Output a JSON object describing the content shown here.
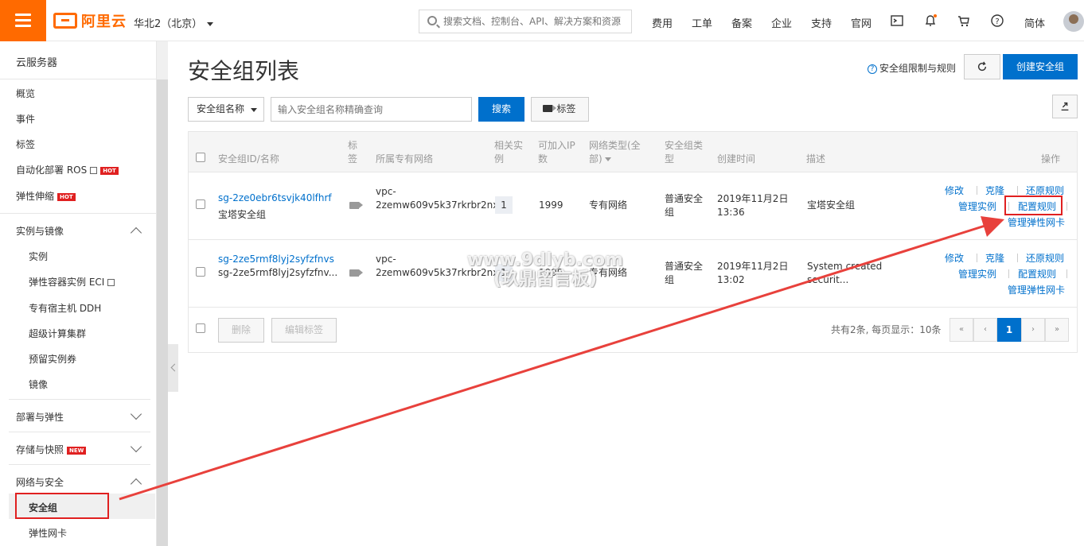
{
  "header": {
    "logo_text": "阿里云",
    "region": "华北2（北京）",
    "search_placeholder": "搜索文档、控制台、API、解决方案和资源",
    "nav": [
      "费用",
      "工单",
      "备案",
      "企业",
      "支持",
      "官网"
    ],
    "lang": "简体"
  },
  "sidebar": {
    "title": "云服务器",
    "top_items": [
      "概览",
      "事件",
      "标签",
      "自动化部署 ROS",
      "弹性伸缩"
    ],
    "hot_badge": "HOT",
    "new_badge": "NEW",
    "groups": {
      "instances": {
        "label": "实例与镜像",
        "items": [
          "实例",
          "弹性容器实例 ECI",
          "专有宿主机 DDH",
          "超级计算集群",
          "预留实例券",
          "镜像"
        ]
      },
      "deploy": {
        "label": "部署与弹性"
      },
      "storage": {
        "label": "存储与快照"
      },
      "network": {
        "label": "网络与安全",
        "items": [
          "安全组",
          "弹性网卡"
        ]
      }
    }
  },
  "main": {
    "title": "安全组列表",
    "help_link": "安全组限制与规则",
    "create_button": "创建安全组",
    "filter_select": "安全组名称",
    "search_placeholder": "输入安全组名称精确查询",
    "search_button": "搜索",
    "tag_button": "标签",
    "columns": {
      "id_name": "安全组ID/名称",
      "tag": "标签",
      "vpc": "所属专有网络",
      "related": "相关实例",
      "ip": "可加入IP数",
      "net_type": "网络类型(全部)",
      "sg_type": "安全组类型",
      "created": "创建时间",
      "desc": "描述",
      "ops": "操作"
    },
    "rows": [
      {
        "id": "sg-2ze0ebr6tsvjk40lfhrf",
        "name": "宝塔安全组",
        "vpc_prefix": "vpc-",
        "vpc": "2zemw609v5k37rkrbr2nx",
        "related": "1",
        "ip": "1999",
        "net_type": "专有网络",
        "sg_type_1": "普通安全",
        "sg_type_2": "组",
        "date": "2019年11月2日",
        "time": "13:36",
        "desc_1": "宝塔安全组",
        "desc_2": ""
      },
      {
        "id": "sg-2ze5rmf8lyj2syfzfnvs",
        "name": "sg-2ze5rmf8lyj2syfzfnv...",
        "vpc_prefix": "vpc-",
        "vpc": "2zemw609v5k37rkrbr2nx",
        "related": "1",
        "ip": "1999",
        "net_type": "专有网络",
        "sg_type_1": "普通安全",
        "sg_type_2": "组",
        "date": "2019年11月2日",
        "time": "13:02",
        "desc_1": "System created",
        "desc_2": "securit..."
      }
    ],
    "ops": {
      "modify": "修改",
      "clone": "克隆",
      "restore": "还原规则",
      "manage_instances": "管理实例",
      "config_rules": "配置规则",
      "manage_eni": "管理弹性网卡"
    },
    "footer": {
      "delete": "删除",
      "edit_tags": "编辑标签",
      "summary": "共有2条, 每页显示：10条",
      "page": "1",
      "first": "«",
      "prev": "‹",
      "next": "›",
      "last": "»"
    }
  },
  "watermark": {
    "line1": "www.9dlyb.com",
    "line2": "(玖鼎留言板)"
  },
  "colors": {
    "brand": "#ff6a00",
    "primary": "#0070cc",
    "annotation": "#e02020"
  }
}
